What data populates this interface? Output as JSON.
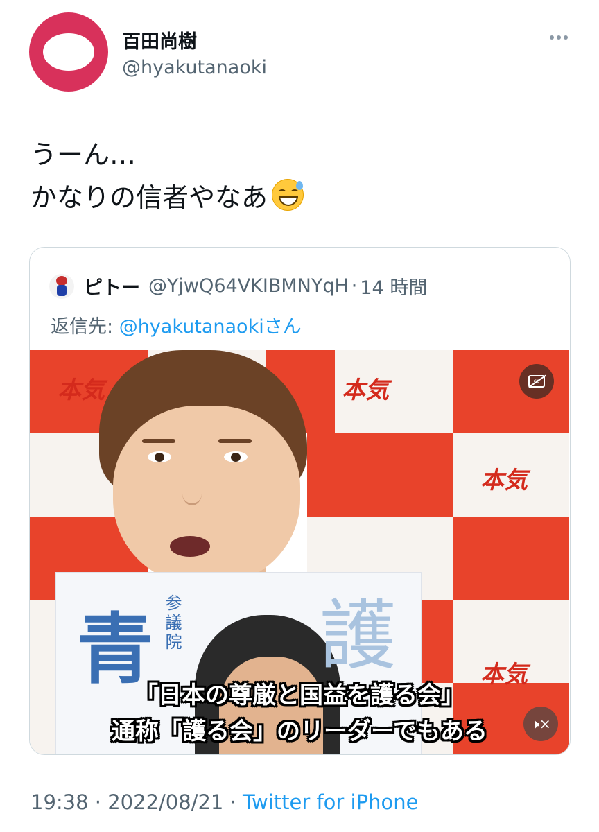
{
  "author": {
    "display_name": "百田尚樹",
    "handle": "@hyakutanaoki"
  },
  "tweet": {
    "lines": [
      "うーん…",
      "かなりの信者やなあ"
    ],
    "emoji": "grinning-face-with-sweat"
  },
  "quoted_tweet": {
    "display_name": "ピトー",
    "handle": "@YjwQ64VKIBMNYqH",
    "separator": "·",
    "time_ago": "14 時間",
    "reply_prefix": "返信先:",
    "reply_mention": "@hyakutanaoki",
    "reply_suffix": "さん",
    "video": {
      "background_text": "本気",
      "poster_text_large": "青",
      "poster_text_vertical": "参議院",
      "poster_text_large_2": "護",
      "subtitle_line1": "「日本の尊厳と国益を護る会」",
      "subtitle_line2": "通称「護る会」のリーダーでもある",
      "cc_icon": "cc-off-icon",
      "mute_icon": "volume-muted-icon"
    }
  },
  "meta": {
    "time": "19:38",
    "dot": "·",
    "date": "2022/08/21",
    "source": "Twitter for iPhone"
  },
  "colors": {
    "link": "#1d9bf0",
    "secondary_text": "#536471",
    "avatar_ring": "#d8315b",
    "backdrop_red": "#e8432b"
  }
}
